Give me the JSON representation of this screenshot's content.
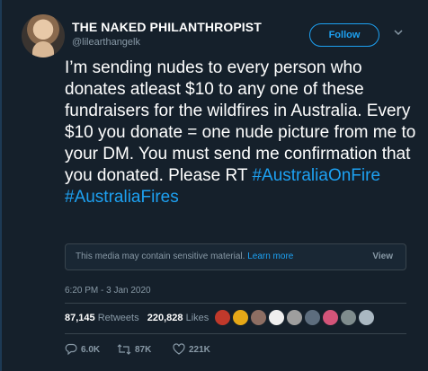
{
  "author": {
    "name": "THE NAKED PHILANTHROPIST",
    "handle": "@lilearthangelk"
  },
  "follow_label": "Follow",
  "tweet": {
    "text": "I’m sending nudes to every person who donates atleast $10 to any one of these fundraisers for the wildfires in Australia. Every $10 you donate = one nude picture from me to your DM. You must send me confirmation that you donated. Please RT ",
    "hashtags": [
      "#AustraliaOnFire",
      "#AustraliaFires"
    ]
  },
  "sensitive_media": {
    "notice": "This media may contain sensitive material.",
    "learn_more": "Learn more",
    "view_label": "View"
  },
  "timestamp": "6:20 PM - 3 Jan 2020",
  "stats": {
    "retweets_count": "87,145",
    "retweets_label": "Retweets",
    "likes_count": "220,828",
    "likes_label": "Likes"
  },
  "liker_avatars": [
    "#c0392b",
    "#e6a817",
    "#8d6e63",
    "#efefef",
    "#9e9e9e",
    "#5d6d7e",
    "#d35479",
    "#7f8c8d",
    "#aab8c2"
  ],
  "actions": {
    "reply_count": "6.0K",
    "retweet_count": "87K",
    "like_count": "221K"
  },
  "colors": {
    "background": "#15202b",
    "accent": "#1da1f2",
    "muted": "#8899a6"
  }
}
